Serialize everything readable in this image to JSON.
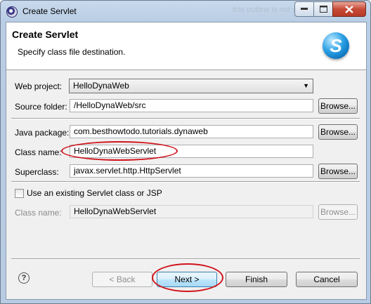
{
  "window": {
    "title": "Create Servlet",
    "ghost_text": "this outline is not ava..."
  },
  "header": {
    "title": "Create Servlet",
    "subtitle": "Specify class file destination.",
    "logo_letter": "S"
  },
  "form": {
    "web_project_label": "Web project:",
    "web_project_value": "HelloDynaWeb",
    "source_folder_label": "Source folder:",
    "source_folder_value": "/HelloDynaWeb/src",
    "java_package_label": "Java package:",
    "java_package_value": "com.besthowtodo.tutorials.dynaweb",
    "class_name_label": "Class name:",
    "class_name_value": "HelloDynaWebServlet",
    "superclass_label": "Superclass:",
    "superclass_value": "javax.servlet.http.HttpServlet",
    "use_existing_label": "Use an existing Servlet class or JSP",
    "existing_class_label": "Class name:",
    "existing_class_value": "HelloDynaWebServlet",
    "browse_label": "Browse..."
  },
  "footer": {
    "help": "?",
    "back": "< Back",
    "next": "Next >",
    "finish": "Finish",
    "cancel": "Cancel"
  },
  "colors": {
    "highlight_oval": "#d0141c",
    "window_frame": "#b9cde4"
  }
}
